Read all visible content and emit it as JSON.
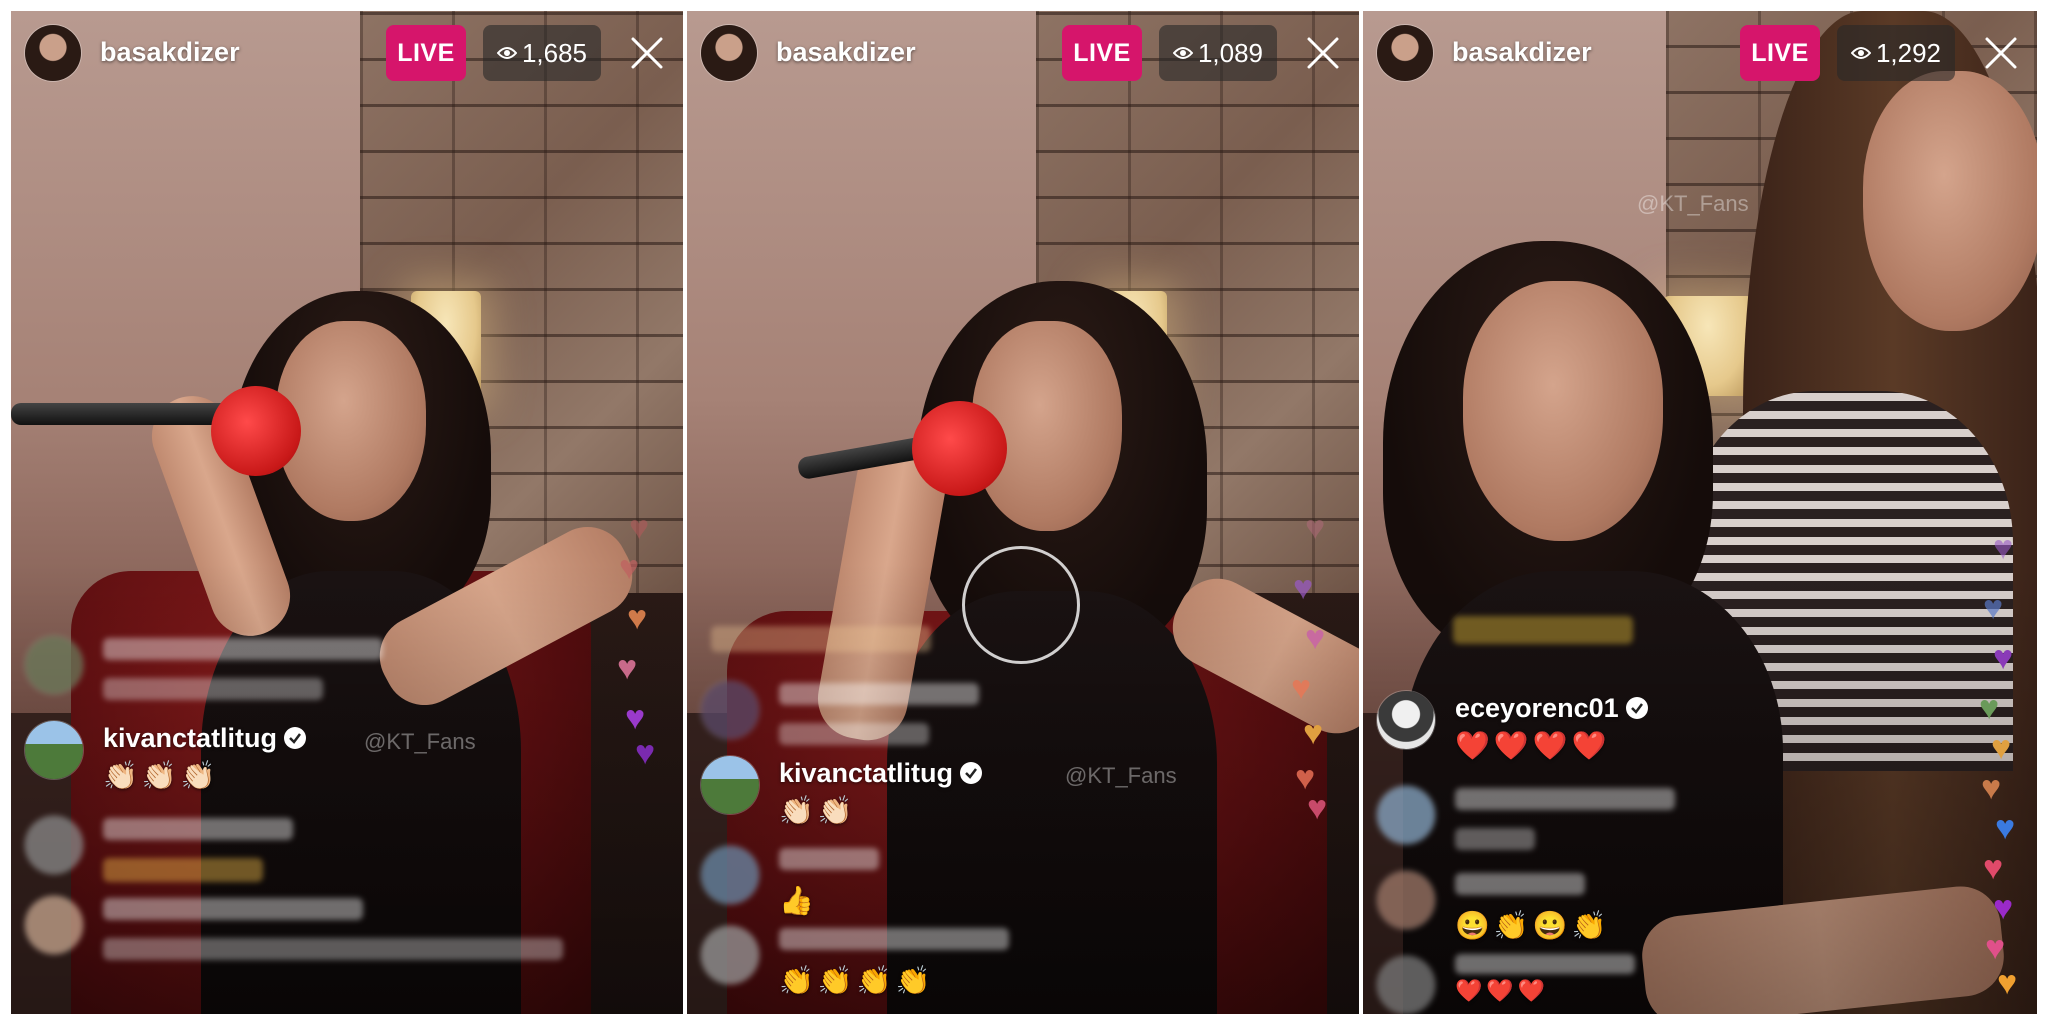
{
  "panels": [
    {
      "username": "basakdizer",
      "live_label": "LIVE",
      "viewer_count": "1,685",
      "watermark": "@KT_Fans",
      "comments": [
        {
          "user": "kivanctatlitug",
          "verified": true,
          "text": "👏🏻👏🏻👏🏻"
        }
      ]
    },
    {
      "username": "basakdizer",
      "live_label": "LIVE",
      "viewer_count": "1,089",
      "watermark": "@KT_Fans",
      "comments": [
        {
          "user": "kivanctatlitug",
          "verified": true,
          "text": "👏🏻👏🏻"
        },
        {
          "user": "",
          "verified": false,
          "text": "👍"
        },
        {
          "user": "",
          "verified": false,
          "text": "👏👏👏👏"
        }
      ]
    },
    {
      "username": "basakdizer",
      "live_label": "LIVE",
      "viewer_count": "1,292",
      "watermark": "@KT_Fans",
      "comments": [
        {
          "user": "eceyorenc01",
          "verified": true,
          "text": "❤️❤️❤️❤️"
        },
        {
          "user": "",
          "verified": false,
          "text": "😀👏😀👏"
        },
        {
          "user": "",
          "verified": false,
          "text": "❤️❤️❤️"
        }
      ]
    }
  ],
  "colors": {
    "live_badge": "#d6156b",
    "viewer_pill": "#282828",
    "verified_badge": "#ffffff"
  },
  "icons": {
    "eye": "eye-icon",
    "close": "close-icon",
    "verified": "verified-icon",
    "heart": "heart-icon"
  }
}
